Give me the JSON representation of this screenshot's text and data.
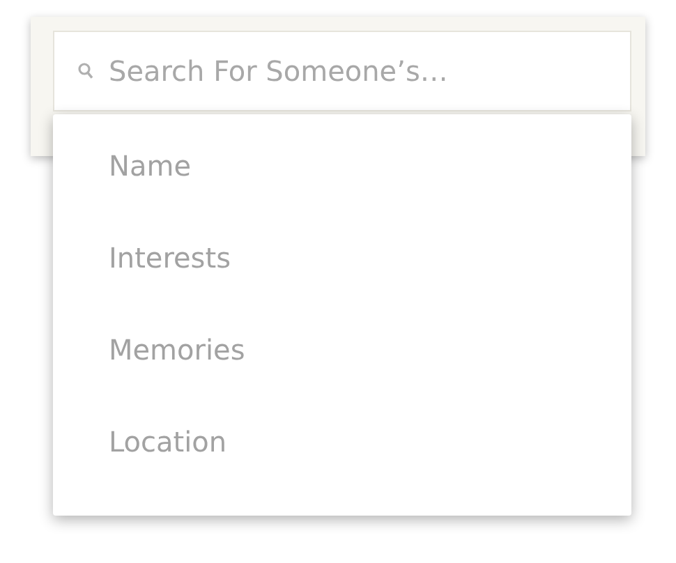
{
  "search": {
    "placeholder": "Search For Someone’s…"
  },
  "menu": {
    "items": [
      {
        "label": "Name"
      },
      {
        "label": "Interests"
      },
      {
        "label": "Memories"
      },
      {
        "label": "Location"
      }
    ]
  }
}
